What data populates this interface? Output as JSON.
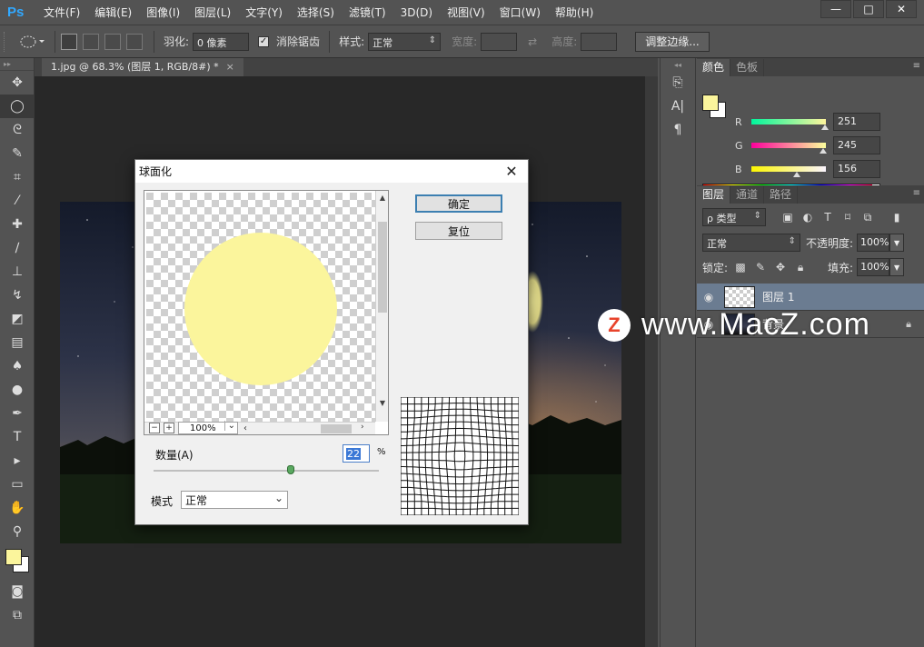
{
  "app": {
    "logo": "Ps"
  },
  "menu": [
    "文件(F)",
    "编辑(E)",
    "图像(I)",
    "图层(L)",
    "文字(Y)",
    "选择(S)",
    "滤镜(T)",
    "3D(D)",
    "视图(V)",
    "窗口(W)",
    "帮助(H)"
  ],
  "window_controls": {
    "minimize": "—",
    "maximize": "□",
    "close": "✕"
  },
  "options_bar": {
    "feather_label": "羽化:",
    "feather_value": "0 像素",
    "antialias_label": "消除锯齿",
    "antialias_checked": true,
    "style_label": "样式:",
    "style_value": "正常",
    "width_label": "宽度:",
    "height_label": "高度:",
    "refine_edge_label": "调整边缘..."
  },
  "document": {
    "tab_title": "1.jpg @ 68.3% (图层 1, RGB/8#) *",
    "tab_close": "×"
  },
  "color_panel": {
    "tabs": [
      "颜色",
      "色板"
    ],
    "fg_color": "#fbf59c",
    "bg_color": "#ffffff",
    "channels": [
      {
        "name": "R",
        "value": "251",
        "level": 0.984
      },
      {
        "name": "G",
        "value": "245",
        "level": 0.961
      },
      {
        "name": "B",
        "value": "156",
        "level": 0.612
      }
    ]
  },
  "layers_panel": {
    "tabs": [
      "图层",
      "通道",
      "路径"
    ],
    "filter_value": "ρ 类型",
    "blend_mode": "正常",
    "opacity_label": "不透明度:",
    "opacity_value": "100%",
    "lock_label": "锁定:",
    "fill_label": "填充:",
    "fill_value": "100%",
    "layers": [
      {
        "name": "图层 1",
        "selected": true
      },
      {
        "name": "背景",
        "selected": false,
        "locked": true
      }
    ]
  },
  "dialog": {
    "title": "球面化",
    "close": "✕",
    "ok_label": "确定",
    "reset_label": "复位",
    "zoom_value": "100%",
    "amount_label": "数量(A)",
    "amount_value": "22",
    "amount_unit": "%",
    "amount_level": 0.61,
    "mode_label": "模式",
    "mode_value": "正常"
  },
  "watermark": {
    "logo": "Z",
    "text": "www.MacZ.com"
  }
}
